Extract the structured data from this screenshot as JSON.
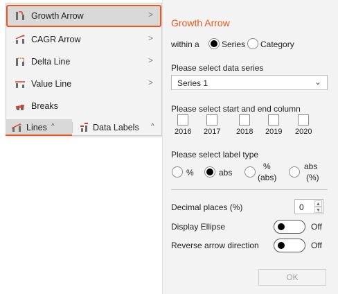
{
  "menu": {
    "items": [
      {
        "label": "Growth Arrow",
        "icon": "growth-arrow-icon",
        "arrow": ">"
      },
      {
        "label": "CAGR Arrow",
        "icon": "cagr-arrow-icon",
        "arrow": ">"
      },
      {
        "label": "Delta Line",
        "icon": "delta-line-icon",
        "arrow": ">"
      },
      {
        "label": "Value Line",
        "icon": "value-line-icon",
        "arrow": ">"
      },
      {
        "label": "Breaks",
        "icon": "breaks-icon"
      }
    ]
  },
  "ribbon": {
    "lines": {
      "label": "Lines",
      "caret": "^"
    },
    "data_labels": {
      "label": "Data Labels",
      "caret": "^"
    }
  },
  "panel": {
    "title": "Growth Arrow",
    "within_label": "within a",
    "within_options": [
      {
        "label": "Series",
        "selected": true
      },
      {
        "label": "Category",
        "selected": false
      }
    ],
    "series_label": "Please select data series",
    "series_value": "Series 1",
    "columns_label": "Please select start and end column",
    "columns": [
      "2016",
      "2017",
      "2018",
      "2019",
      "2020"
    ],
    "label_type_label": "Please select label type",
    "label_types": [
      {
        "label": "%",
        "selected": false
      },
      {
        "label": "abs",
        "selected": true
      },
      {
        "label_top": "%",
        "label_bottom": "(abs)",
        "selected": false
      },
      {
        "label_top": "abs",
        "label_bottom": "(%)",
        "selected": false
      }
    ],
    "decimal_label": "Decimal places (%)",
    "decimal_value": "0",
    "ellipse_label": "Display Ellipse",
    "ellipse_state": "Off",
    "reverse_label": "Reverse arrow direction",
    "reverse_state": "Off",
    "ok_label": "OK"
  },
  "colors": {
    "accent": "#e8581c",
    "icon_red": "#d9402a",
    "icon_gray": "#6b6b6b"
  }
}
